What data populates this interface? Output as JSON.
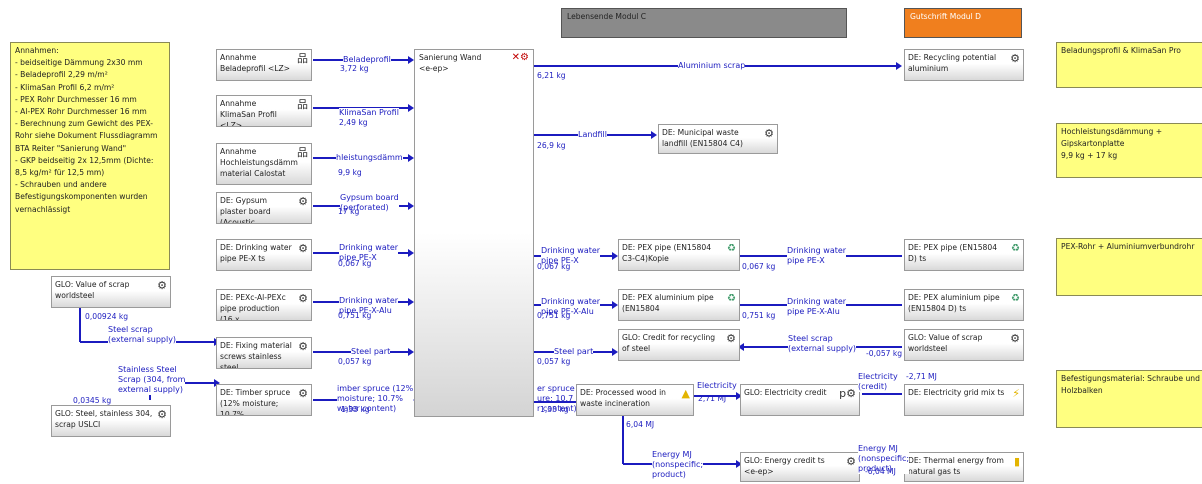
{
  "headers": {
    "module_c": "Lebensende Modul C",
    "module_d": "Gutschrift Modul D"
  },
  "notes": {
    "assumptions": "Annahmen:\n- beidseitige Dämmung 2x30 mm\n- Beladeprofil 2,29 m/m²\n- KlimaSan Profil 6,2 m/m²\n- PEX Rohr Durchmesser 16 mm\n- Al-PEX Rohr Durchmesser 16 mm\n- Berechnung zum Gewicht des PEX-Rohr siehe Dokument Flussdiagramm BTA Reiter \"Sanierung Wand\"\n- GKP beidseitig 2x 12,5mm (Dichte: 8,5 kg/m² für 12,5 mm)\n- Schrauben und andere Befestigungskomponenten wurden vernachlässigt",
    "right1": "Beladungsprofil & KlimaSan Pro",
    "right2": "Hochleistungsdämmung + Gipskartonplatte\n9,9 kg + 17 kg",
    "right3": "PEX-Rohr + Aluminiumverbundrohr",
    "right4": "Befestigungsmaterial: Schraube und Holzbalken"
  },
  "processes": {
    "annahme_belade": "Annahme Beladeprofil <LZ>",
    "annahme_klimasan": "Annahme KlimaSan Profil <LZ>",
    "annahme_hochleistung": "Annahme Hochleistungsdämm material Calostat",
    "gypsum": "DE: Gypsum plaster board (Acoustic",
    "drinking_pex": "DE: Drinking water pipe PE-X ts",
    "pexc": "DE: PEXc-Al-PEXc pipe production (16 x",
    "fixing": "DE: Fixing material screws stainless steel",
    "timber": "DE: Timber spruce (12% moisture; 10.7%",
    "glo_scrap_left": "GLO: Value of scrap worldsteel",
    "glo_steel_left": "GLO: Steel, stainless 304, scrap USLCI",
    "sanierung": "Sanierung Wand",
    "sanierung_sub": "<e-ep>",
    "recycling_alu": "DE: Recycling potential aluminium",
    "landfill": "DE: Municipal waste landfill (EN15804 C4)",
    "pex_c3": "DE: PEX pipe (EN15804 C3-C4)Kopie",
    "pex_alu_c": "DE: PEX aluminium pipe (EN15804",
    "credit_steel": "GLO: Credit for recycling of steel",
    "processed_wood": "DE: Processed wood in waste incineration",
    "elec_credit": "GLO: Electricity credit",
    "energy_credit": "GLO: Energy credit ts",
    "energy_credit_sub": "<e-ep>",
    "pex_d": "DE: PEX pipe (EN15804 D) ts",
    "pex_alu_d": "DE: PEX aluminium pipe (EN15804 D) ts",
    "glo_scrap_right": "GLO: Value of scrap worldsteel",
    "elec_grid": "DE: Electricity grid mix ts",
    "thermal": "DE: Thermal energy from natural gas ts"
  },
  "flows": {
    "beladeprofil": "Beladeprofil",
    "beladeprofil_amt": "3,72 kg",
    "klimasan": "KlimaSan Profil",
    "klimasan_amt": "2,49 kg",
    "hochleistung": "hleistungsdämm",
    "hochleistung_amt": "9,9 kg",
    "gypsum": "Gypsum board\n(perforated)",
    "gypsum_amt": "17 kg",
    "dw_pex": "Drinking water\npipe PE-X",
    "dw_pex_amt": "0,067 kg",
    "dw_alu": "Drinking water\npipe PE-X-Alu",
    "dw_alu_amt": "0,751 kg",
    "steel_part": "Steel part",
    "steel_part_amt": "0,057 kg",
    "timber_in": "imber spruce (12%\nmoisture; 10.7%\nwater content)",
    "timber_in_amt": "1,33 kg",
    "alu_scrap": "Aluminium scrap",
    "alu_scrap_amt": "6,21 kg",
    "landfill": "Landfill",
    "landfill_amt": "26,9 kg",
    "dw_pex_out": "Drinking water\npipe PE-X",
    "dw_pex_out_amt": "0,067 kg",
    "dw_pex_c3": "Drinking water\npipe PE-X",
    "dw_pex_c3_amt": "0,067 kg",
    "dw_alu_out": "Drinking water\npipe PE-X-Alu",
    "dw_alu_out_amt": "0,751 kg",
    "dw_alu_c": "Drinking water\npipe PE-X-Alu",
    "dw_alu_c_amt": "0,751 kg",
    "steel_part_out": "Steel part",
    "steel_part_out_amt": "0,057 kg",
    "steel_scrap_right": "Steel scrap\n(external supply)",
    "steel_scrap_right_amt": "-0,057 kg",
    "timber_out": "er spruce\nure; 10.7\nr content)",
    "timber_out_amt": "1,33 kg",
    "electricity": "Electricity",
    "electricity_amt": "2,71 MJ",
    "electricity_credit": "Electricity\n(credit)",
    "electricity_credit_amt": "-2,71 MJ",
    "energy_amt": "6,04 MJ",
    "energy_mj": "Energy MJ\n(nonspecific;\nproduct)",
    "energy_nonspec": "Energy MJ\n(nonspecific;\nproduct)",
    "energy_neg_amt": "-6,04 MJ",
    "scrap_left_amt": "0,00924 kg",
    "steel_scrap_left": "Steel scrap\n(external supply)",
    "stainless": "Stainless Steel\nScrap (304, from\nexternal supply)",
    "stainless_amt": "0,0345 kg"
  },
  "colors": {
    "flow": "#1b1bbf",
    "note_bg": "#ffff80",
    "header_c": "#8a8a8a",
    "header_d": "#f07f1e"
  }
}
